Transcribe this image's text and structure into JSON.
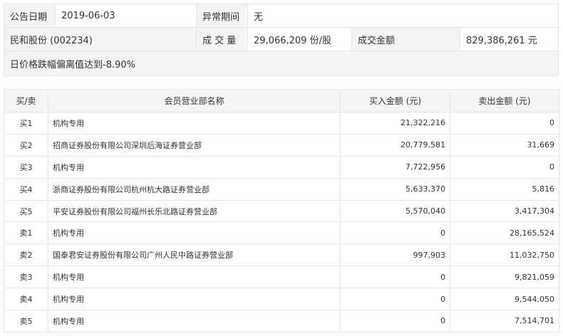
{
  "info": {
    "date_label": "公告日期",
    "date_value": "2019-06-03",
    "period_label": "异常期间",
    "period_value": "无",
    "stock": "民和股份 (002234)",
    "volume_label": "成 交 量",
    "volume_value": "29,066,209 份/股",
    "amount_label": "成交金额",
    "amount_value": "829,386,261 元",
    "reason": "日价格跌幅偏离值达到-8.90%"
  },
  "table": {
    "headers": {
      "side": "买/卖",
      "name": "会员营业部名称",
      "buy": "买入金额 (元)",
      "sell": "卖出金额 (元)"
    },
    "rows": [
      {
        "side": "买1",
        "name": "机构专用",
        "buy": "21,322,216",
        "sell": "0"
      },
      {
        "side": "买2",
        "name": "招商证券股份有限公司深圳后海证券营业部",
        "buy": "20,779,581",
        "sell": "31,669"
      },
      {
        "side": "买3",
        "name": "机构专用",
        "buy": "7,722,956",
        "sell": "0"
      },
      {
        "side": "买4",
        "name": "浙商证券股份有限公司杭州杭大路证券营业部",
        "buy": "5,633,370",
        "sell": "5,816"
      },
      {
        "side": "买5",
        "name": "平安证券股份有限公司福州长乐北路证券营业部",
        "buy": "5,570,040",
        "sell": "3,417,304"
      },
      {
        "side": "卖1",
        "name": "机构专用",
        "buy": "0",
        "sell": "28,165,524"
      },
      {
        "side": "卖2",
        "name": "国泰君安证券股份有限公司广州人民中路证券营业部",
        "buy": "997,903",
        "sell": "11,032,750"
      },
      {
        "side": "卖3",
        "name": "机构专用",
        "buy": "0",
        "sell": "9,821,059"
      },
      {
        "side": "卖4",
        "name": "机构专用",
        "buy": "0",
        "sell": "9,544,050"
      },
      {
        "side": "卖5",
        "name": "机构专用",
        "buy": "0",
        "sell": "7,514,701"
      }
    ]
  }
}
